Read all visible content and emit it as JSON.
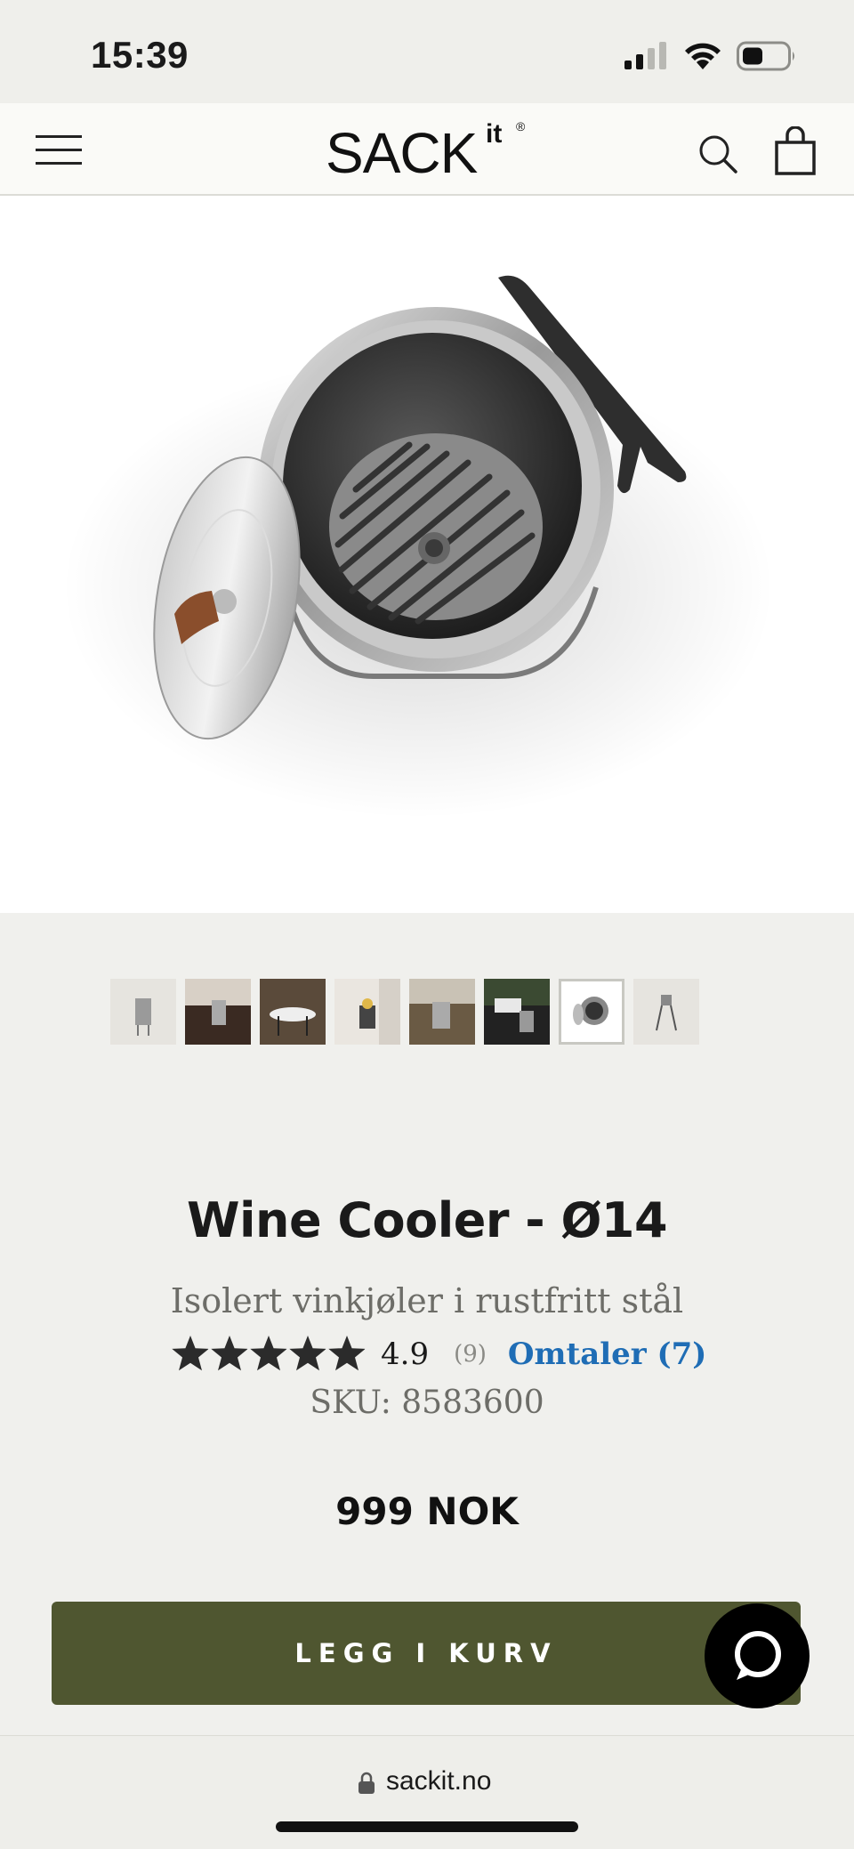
{
  "status_bar": {
    "time": "15:39"
  },
  "header": {
    "logo_main": "SACK",
    "logo_sup": "it",
    "logo_reg": "®",
    "icons": [
      "menu-icon",
      "search-icon",
      "cart-icon"
    ]
  },
  "gallery": {
    "thumbnail_count": 8,
    "active_index": 6
  },
  "product": {
    "title": "Wine Cooler - Ø14",
    "subtitle": "Isolert vinkjøler i rustfritt stål",
    "rating_value": "4.9",
    "rating_fraction": 0.98,
    "rating_count": "(9)",
    "reviews_link": "Omtaler (7)",
    "sku": "SKU: 8583600",
    "price": "999 NOK"
  },
  "actions": {
    "add_to_cart": "LEGG I KURV"
  },
  "colors": {
    "button_bg": "#4f5630",
    "link": "#1f6db5",
    "page_bg": "#f0f0ed"
  },
  "browser": {
    "url": "sackit.no"
  }
}
